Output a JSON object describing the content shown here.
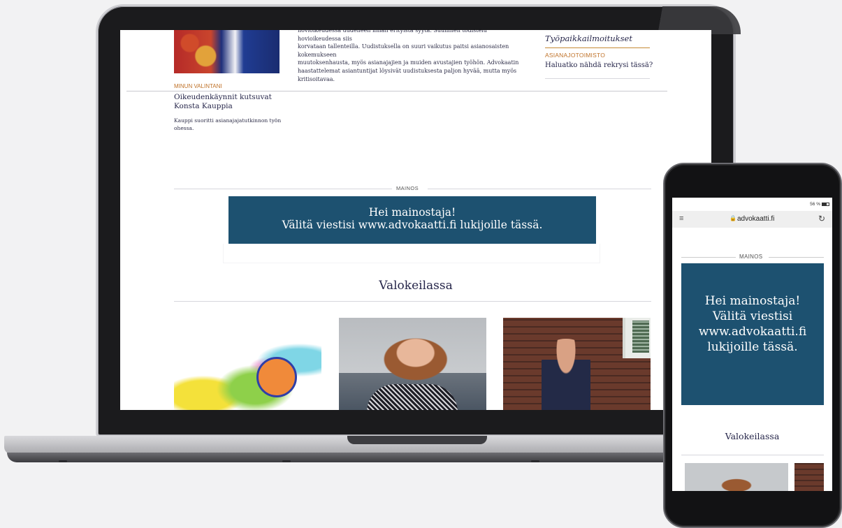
{
  "laptop": {
    "article": {
      "excerpt_lines": [
        "hovioikeudessa uudelleen ilman erityistä syytä. Suullinen todistelu hovioikeudessa siis",
        "korvataan tallenteilla. Uudistuksella on suuri vaikutus paitsi asianosaisten kokemukseen",
        "muutoksenhausta, myös asianajajien ja muiden avustajien työhön. Advokaatin",
        "haastattelemat asiantuntijat löysivät uudistuksesta paljon hyvää, mutta myös",
        "kritisoitavaa."
      ]
    },
    "sidebar": {
      "heading": "Työpaikkailmoitukset",
      "category": "ASIANAJOTOIMISTO",
      "link": "Haluatko nähdä rekrysi tässä?"
    },
    "my_pick": {
      "category": "MINUN VALINTANI",
      "title": "Oikeudenkäynnit kutsuvat Konsta Kauppia",
      "text": "Kauppi suoritti asianajajatutkinnon työn ohessa."
    },
    "ad": {
      "label": "MAINOS",
      "line1": "Hei mainostaja!",
      "line2": "Välitä viestisi www.advokaatti.fi lukijoille tässä."
    },
    "section_title": "Valokeilassa"
  },
  "phone": {
    "status": "56 %",
    "url": "advokaatti.fi",
    "menu_icon": "≡",
    "lock_icon": "🔒",
    "reload_icon": "↻",
    "ad": {
      "label": "MAINOS",
      "line1": "Hei mainostaja!",
      "line2": "Välitä viestisi",
      "line3": "www.advokaatti.fi",
      "line4": "lukijoille tässä."
    },
    "section_title": "Valokeilassa"
  },
  "colors": {
    "ad_background": "#1d5170",
    "accent_orange": "#c0732a",
    "heading_navy": "#26264a"
  }
}
